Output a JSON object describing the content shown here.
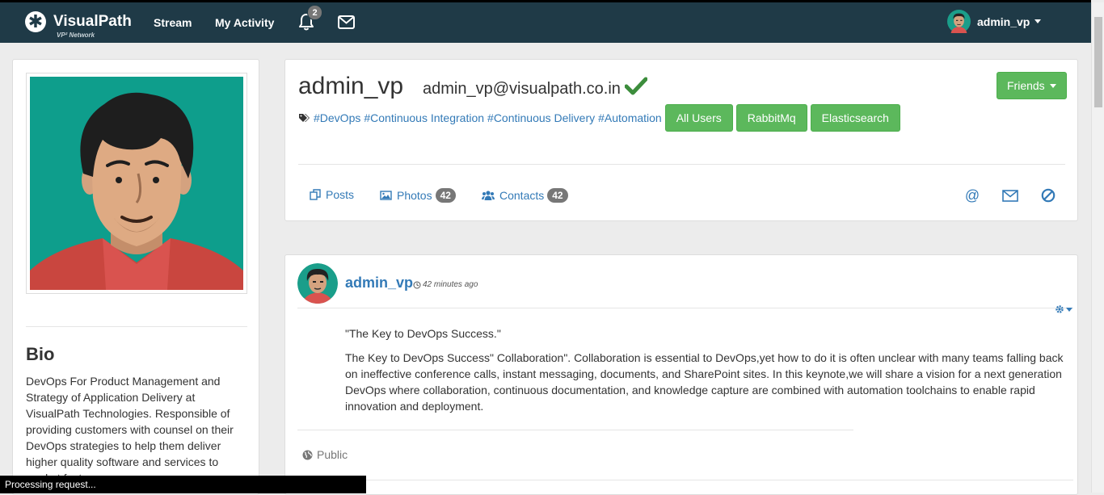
{
  "navbar": {
    "brand_name": "VisualPath",
    "brand_subtitle": "VP² Network",
    "links": {
      "stream": "Stream",
      "activity": "My Activity"
    },
    "notifications_count": "2",
    "user_name": "admin_vp",
    "bg_color": "#1f3a47"
  },
  "sidebar": {
    "bio_title": "Bio",
    "bio_text": "DevOps For Product Management and Strategy of Application Delivery at VisualPath Technologies. Responsible of providing customers with counsel on their DevOps strategies to help them deliver higher quality software and services to market faster."
  },
  "profile": {
    "name": "admin_vp",
    "email": "admin_vp@visualpath.co.in",
    "friends_label": "Friends",
    "tags": {
      "devops": "#DevOps",
      "ci": "#Continuous Integration",
      "cd": "#Continuous Delivery",
      "automation": "#Automation"
    },
    "tag_buttons": {
      "all_users": "All Users",
      "rabbitmq": "RabbitMq",
      "elasticsearch": "Elasticsearch"
    },
    "tabs": {
      "posts": "Posts",
      "photos": "Photos",
      "photos_count": "42",
      "contacts": "Contacts",
      "contacts_count": "42"
    },
    "accent_color": "#5cb85c",
    "link_color": "#337ab7"
  },
  "post": {
    "author": "admin_vp",
    "time": "42 minutes ago",
    "title": "\"The Key to DevOps Success.\"",
    "body": "The Key to DevOps Success\" Collaboration\". Collaboration is essential to DevOps,yet how to do it is often unclear with many teams falling back on ineffective conference calls, instant messaging, documents, and SharePoint sites. In this keynote,we will share a vision for a next generation DevOps where collaboration, continuous documentation, and knowledge capture are combined with automation toolchains to enable rapid innovation and deployment.",
    "visibility": "Public"
  },
  "status": {
    "message": "Processing request..."
  }
}
